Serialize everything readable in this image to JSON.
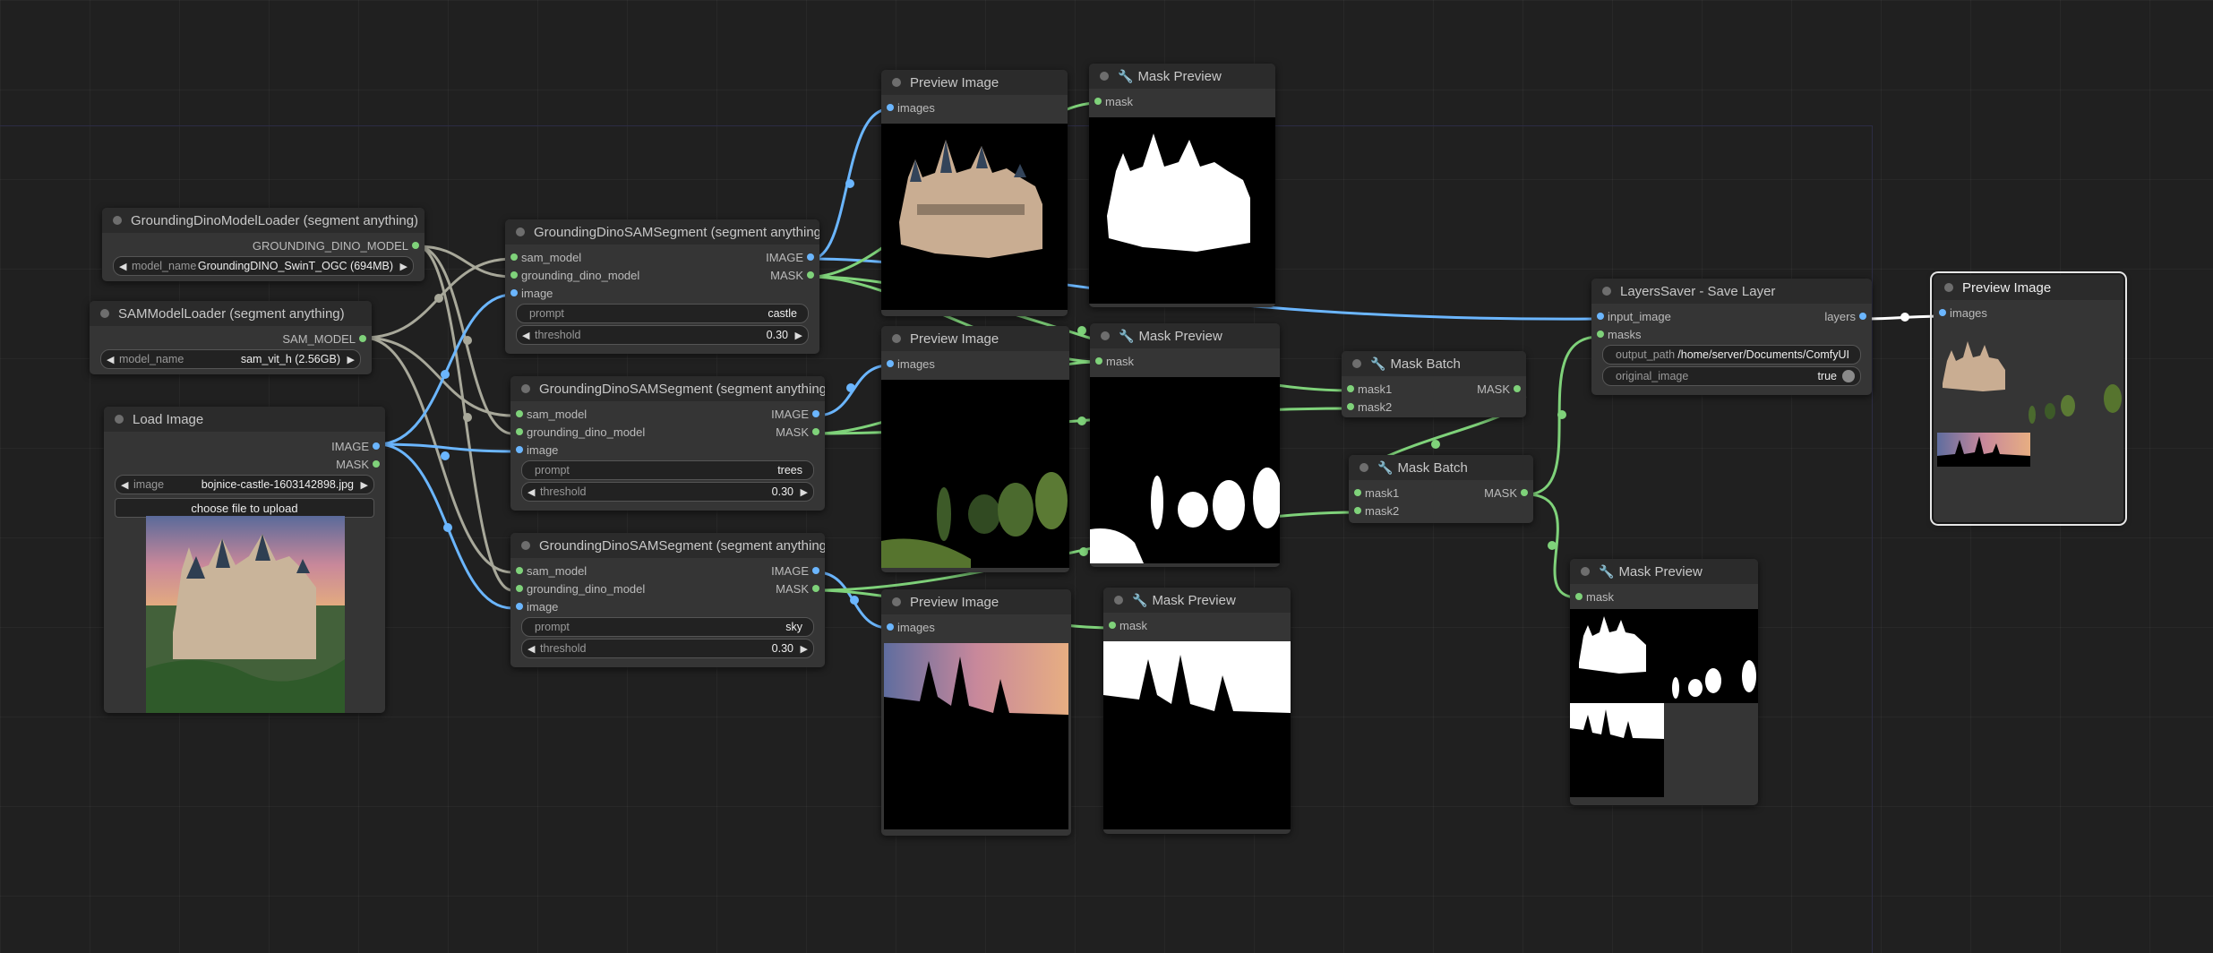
{
  "nodes": {
    "gdino_loader": {
      "title": "GroundingDinoModelLoader (segment anything)",
      "output": "GROUNDING_DINO_MODEL",
      "widget_label": "model_name",
      "widget_value": "GroundingDINO_SwinT_OGC (694MB)"
    },
    "sam_loader": {
      "title": "SAMModelLoader (segment anything)",
      "output": "SAM_MODEL",
      "widget_label": "model_name",
      "widget_value": "sam_vit_h (2.56GB)"
    },
    "load_image": {
      "title": "Load Image",
      "outputs": [
        "IMAGE",
        "MASK"
      ],
      "widget_label": "image",
      "widget_value": "bojnice-castle-1603142898.jpg",
      "upload_button": "choose file to upload"
    },
    "seg1": {
      "title": "GroundingDinoSAMSegment (segment anything)",
      "inputs": [
        "sam_model",
        "grounding_dino_model",
        "image"
      ],
      "outputs": [
        "IMAGE",
        "MASK"
      ],
      "prompt_label": "prompt",
      "prompt_value": "castle",
      "threshold_label": "threshold",
      "threshold_value": "0.30"
    },
    "seg2": {
      "title": "GroundingDinoSAMSegment (segment anything)",
      "inputs": [
        "sam_model",
        "grounding_dino_model",
        "image"
      ],
      "outputs": [
        "IMAGE",
        "MASK"
      ],
      "prompt_label": "prompt",
      "prompt_value": "trees",
      "threshold_label": "threshold",
      "threshold_value": "0.30"
    },
    "seg3": {
      "title": "GroundingDinoSAMSegment (segment anything)",
      "inputs": [
        "sam_model",
        "grounding_dino_model",
        "image"
      ],
      "outputs": [
        "IMAGE",
        "MASK"
      ],
      "prompt_label": "prompt",
      "prompt_value": "sky",
      "threshold_label": "threshold",
      "threshold_value": "0.30"
    },
    "preview1": {
      "title": "Preview Image",
      "input": "images"
    },
    "preview2": {
      "title": "Preview Image",
      "input": "images"
    },
    "preview3": {
      "title": "Preview Image",
      "input": "images"
    },
    "maskprev1": {
      "title": "Mask Preview",
      "input": "mask"
    },
    "maskprev2": {
      "title": "Mask Preview",
      "input": "mask"
    },
    "maskprev3": {
      "title": "Mask Preview",
      "input": "mask"
    },
    "maskprev4": {
      "title": "Mask Preview",
      "input": "mask"
    },
    "maskbatch1": {
      "title": "Mask Batch",
      "inputs": [
        "mask1",
        "mask2"
      ],
      "output": "MASK"
    },
    "maskbatch2": {
      "title": "Mask Batch",
      "inputs": [
        "mask1",
        "mask2"
      ],
      "output": "MASK"
    },
    "layers_saver": {
      "title": "LayersSaver - Save Layer",
      "inputs": [
        "input_image",
        "masks"
      ],
      "output": "layers",
      "output_path_label": "output_path",
      "output_path_value": "/home/server/Documents/ComfyUI",
      "original_image_label": "original_image",
      "original_image_value": "true"
    },
    "preview_final": {
      "title": "Preview Image",
      "input": "images"
    }
  },
  "icons": {
    "wrench": "wrench-icon",
    "arrow_left": "arrow-left-icon",
    "arrow_right": "arrow-right-icon"
  },
  "colors": {
    "mask_link": "#7fd27a",
    "image_link": "#6bb6ff",
    "model_link": "#a8a89a",
    "node_bg": "#353535",
    "title_bg": "#2b2b2b",
    "canvas": "#202020"
  }
}
